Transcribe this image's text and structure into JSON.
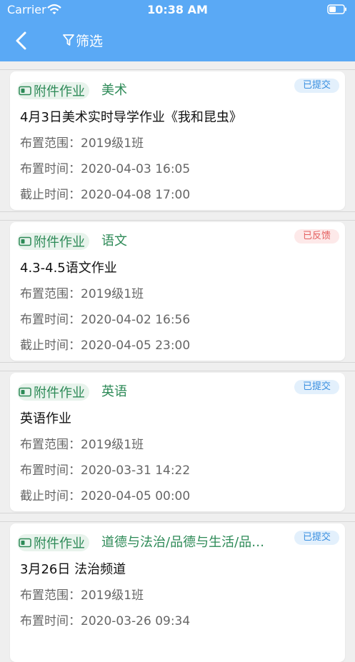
{
  "status_bar": {
    "carrier": "Carrier",
    "time": "10:38 AM"
  },
  "nav": {
    "filter_label": "筛选"
  },
  "labels": {
    "scope": "布置范围：",
    "assigned": "布置时间：",
    "deadline": "截止时间："
  },
  "colors": {
    "header": "#5aa9f5",
    "tag_green": "#2d8a57",
    "badge_blue": "#3a8fe0",
    "badge_red": "#e45f5f"
  },
  "assignments": [
    {
      "type": "附件作业",
      "subject": "美术",
      "status": "已提交",
      "status_kind": "submitted",
      "title": "4月3日美术实时导学作业《我和昆虫》",
      "scope": "2019级1班",
      "assigned_time": "2020-04-03 16:05",
      "deadline": "2020-04-08 17:00"
    },
    {
      "type": "附件作业",
      "subject": "语文",
      "status": "已反馈",
      "status_kind": "feedback",
      "title": "4.3-4.5语文作业",
      "scope": "2019级1班",
      "assigned_time": "2020-04-02 16:56",
      "deadline": "2020-04-05 23:00"
    },
    {
      "type": "附件作业",
      "subject": "英语",
      "status": "已提交",
      "status_kind": "submitted",
      "title": "英语作业",
      "scope": "2019级1班",
      "assigned_time": "2020-03-31 14:22",
      "deadline": "2020-04-05 00:00"
    },
    {
      "type": "附件作业",
      "subject": "道德与法治/品德与生活/品…",
      "status": "已提交",
      "status_kind": "submitted",
      "title": "3月26日 法治频道",
      "scope": "2019级1班",
      "assigned_time": "2020-03-26 09:34",
      "deadline": ""
    }
  ]
}
